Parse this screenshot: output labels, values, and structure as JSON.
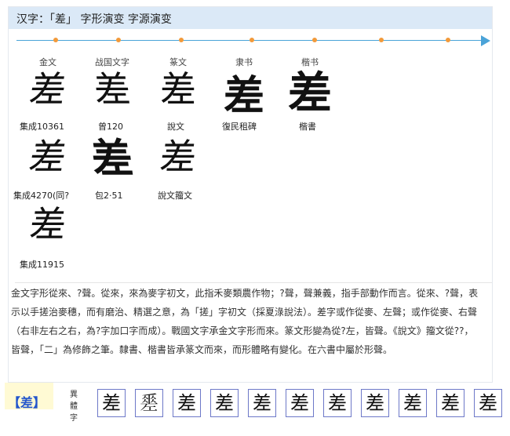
{
  "header": {
    "title": "汉字：「差」 字形演变 字源演变"
  },
  "timeline": {
    "color": "#4aa3d8",
    "dot_color": "#f29a3a"
  },
  "stages": [
    {
      "label": "金文"
    },
    {
      "label": "战国文字"
    },
    {
      "label": "篆文"
    },
    {
      "label": "隶书"
    },
    {
      "label": "楷书"
    }
  ],
  "forms": [
    {
      "glyph": "差",
      "caption": "集成10361"
    },
    {
      "glyph": "差",
      "caption": "曾120"
    },
    {
      "glyph": "差",
      "caption": "說文"
    },
    {
      "glyph": "差",
      "caption": "復民租碑"
    },
    {
      "glyph": "差",
      "caption": "楷書"
    },
    {
      "glyph": "差",
      "caption": "集成4270(同?"
    },
    {
      "glyph": "差",
      "caption": "包2·51"
    },
    {
      "glyph": "差",
      "caption": "說文籀文"
    },
    {
      "glyph": "差",
      "caption": "集成11915"
    }
  ],
  "description": "金文字形從來、?聲。從來，來為麥字初文，此指禾麥類農作物；?聲，聲兼義，指手部動作而言。從來、?聲，表示以手搓治麥穗，而有磨治、精選之意，為「搓」字初文（採夏淥說法）。差字或作從麥、左聲；或作從麥、右聲（右非左右之右，為?字加口字而成）。戰國文字承金文字形而來。篆文形變為從?左，皆聲。《說文》籀文從??，皆聲，「二」為修飾之筆。隸書、楷書皆承篆文而來，而形體略有變化。在六書中屬於形聲。",
  "variants": {
    "head": "【差】",
    "label": "異體字",
    "items": [
      "差",
      "𢀩",
      "差",
      "差",
      "差",
      "差",
      "差",
      "差",
      "差",
      "差",
      "差"
    ]
  }
}
